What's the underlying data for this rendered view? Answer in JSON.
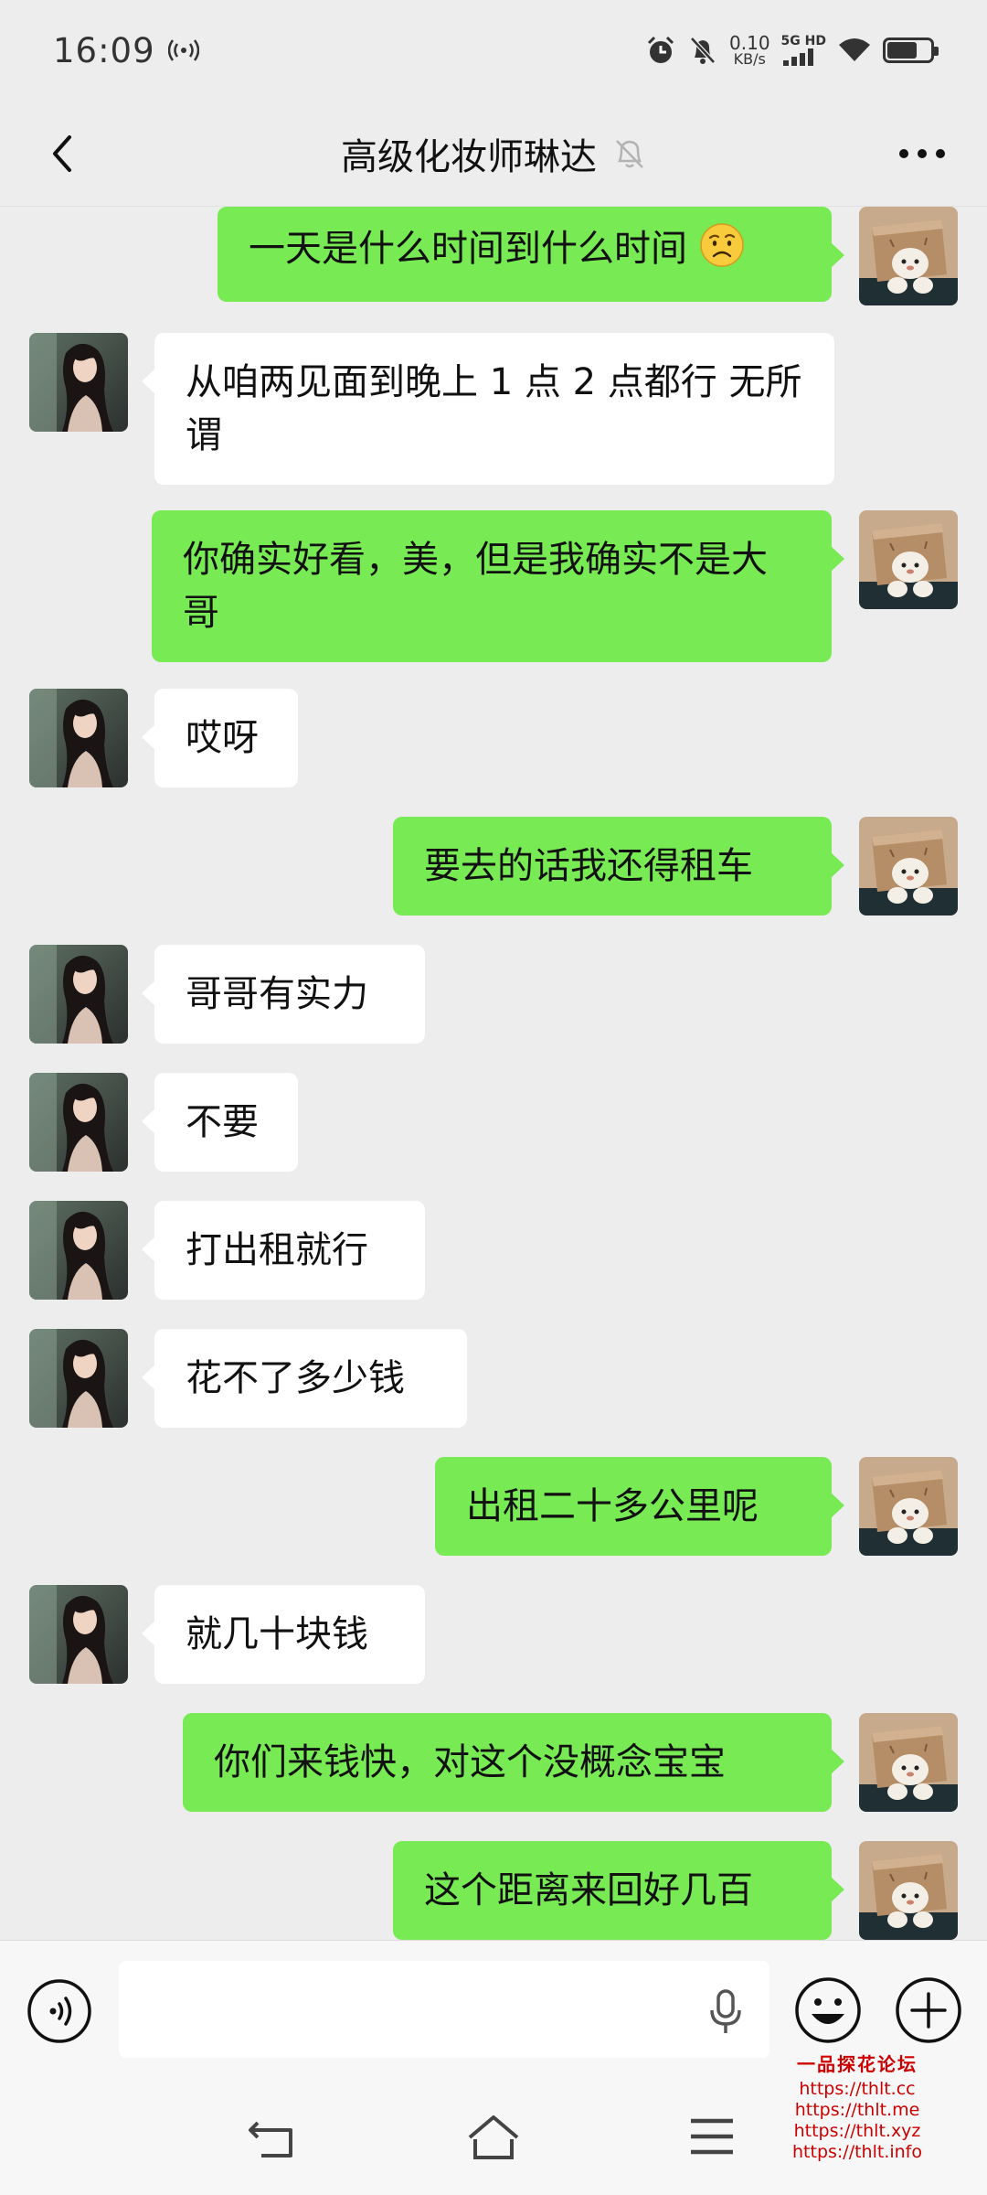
{
  "status_bar": {
    "time": "16:09",
    "speed_value": "0.10",
    "speed_unit": "KB/s",
    "network": "5G HD",
    "battery_level": 0.7
  },
  "header": {
    "title": "高级化妆师琳达",
    "muted": true
  },
  "messages": [
    {
      "side": "out",
      "text": "一天是什么时间到什么时间",
      "emoji": "confused-face"
    },
    {
      "side": "in",
      "text": "从咱两见面到晚上 1 点 2 点都行 无所谓"
    },
    {
      "side": "out",
      "text": "你确实好看，美，但是我确实不是大哥"
    },
    {
      "side": "in",
      "text": "哎呀"
    },
    {
      "side": "out",
      "text": "要去的话我还得租车"
    },
    {
      "side": "in",
      "text": "哥哥有实力"
    },
    {
      "side": "in",
      "text": "不要"
    },
    {
      "side": "in",
      "text": "打出租就行"
    },
    {
      "side": "in",
      "text": "花不了多少钱"
    },
    {
      "side": "out",
      "text": "出租二十多公里呢"
    },
    {
      "side": "in",
      "text": "就几十块钱"
    },
    {
      "side": "out",
      "text": "你们来钱快，对这个没概念宝宝"
    },
    {
      "side": "out",
      "text": "这个距离来回好几百"
    }
  ],
  "input_bar": {
    "value": "",
    "placeholder": ""
  },
  "watermark": {
    "title": "一品探花论坛",
    "lines": [
      "https://thlt.cc",
      "https://thlt.me",
      "https://thlt.xyz",
      "https://thlt.info"
    ]
  },
  "colors": {
    "background": "#ededed",
    "outgoing_bubble": "#77ea54",
    "incoming_bubble": "#ffffff",
    "watermark": "#cc0000"
  }
}
